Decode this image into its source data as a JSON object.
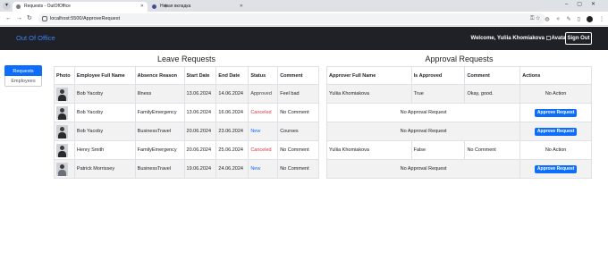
{
  "browser": {
    "tabs": [
      {
        "title": "Requests - OutOfOffice",
        "active": true
      },
      {
        "title": "Новая вкладка",
        "active": false
      }
    ],
    "url": "localhost:5500/ApproveRequest"
  },
  "navbar": {
    "brand": "Out Of Office",
    "welcome": "Welcome, Yuliia Khomiakova",
    "avatar_alt": "Avatar",
    "signout_label": "Sign Out"
  },
  "sidemenu": {
    "items": [
      {
        "label": "Requests",
        "active": true
      },
      {
        "label": "Employees",
        "active": false
      }
    ]
  },
  "leave": {
    "title": "Leave Requests",
    "columns": [
      "Photo",
      "Employee Full Name",
      "Absence Reason",
      "Start Date",
      "End Date",
      "Status",
      "Comment"
    ],
    "rows": [
      {
        "name": "Bob Yacoby",
        "reason": "Illness",
        "start": "13.06.2024",
        "end": "14.06.2024",
        "status": "Approved",
        "comment": "Feel bad"
      },
      {
        "name": "Bob Yacoby",
        "reason": "FamilyEmergency",
        "start": "13.06.2024",
        "end": "16.06.2024",
        "status": "Canceled",
        "comment": "No Comment"
      },
      {
        "name": "Bob Yacoby",
        "reason": "BusinessTravel",
        "start": "20.06.2024",
        "end": "23.06.2024",
        "status": "New",
        "comment": "Courses"
      },
      {
        "name": "Henry Smith",
        "reason": "FamilyEmergency",
        "start": "20.06.2024",
        "end": "25.06.2024",
        "status": "Canceled",
        "comment": "No Comment"
      },
      {
        "name": "Patrick Morrissey",
        "reason": "BusinessTravel",
        "start": "19.06.2024",
        "end": "24.06.2024",
        "status": "New",
        "comment": "No Comment"
      }
    ]
  },
  "approval": {
    "title": "Approval Requests",
    "columns": [
      "Approver Full Name",
      "Is Approved",
      "Comment",
      "Actions"
    ],
    "no_request_text": "No Approval Request",
    "no_action_text": "No Action",
    "approve_label": "Approve Request",
    "rows": [
      {
        "approver": "Yuliia Khomiakova",
        "approved": "True",
        "comment": "Okay, good."
      },
      {},
      {},
      {
        "approver": "Yuliia Khomiakova",
        "approved": "False",
        "comment": "No Comment"
      },
      {}
    ]
  },
  "colors": {
    "primary": "#0d6efd",
    "navbar_bg": "#1f2126",
    "brand": "#3b82f6",
    "canceled": "#dc3545"
  }
}
